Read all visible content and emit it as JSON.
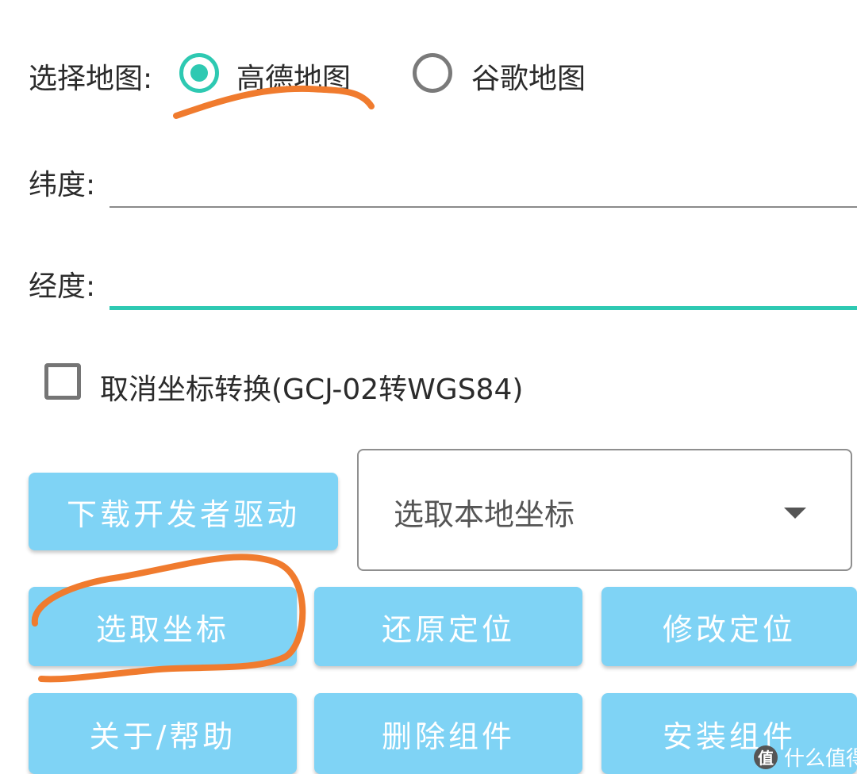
{
  "map_select": {
    "label": "选择地图:",
    "options": [
      {
        "label": "高德地图",
        "checked": true
      },
      {
        "label": "谷歌地图",
        "checked": false
      }
    ]
  },
  "latitude": {
    "label": "纬度:",
    "value": ""
  },
  "longitude": {
    "label": "经度:",
    "value": ""
  },
  "cancel_transform": {
    "label": "取消坐标转换(GCJ-02转WGS84)",
    "checked": false
  },
  "buttons": {
    "download_driver": "下载开发者驱动",
    "pick_coord": "选取坐标",
    "restore_location": "还原定位",
    "modify_location": "修改定位",
    "about_help": "关于/帮助",
    "delete_component": "删除组件",
    "install_component": "安装组件"
  },
  "local_coord_select": {
    "selected": "选取本地坐标"
  },
  "watermark": {
    "badge": "值",
    "text": "什么值得买"
  },
  "colors": {
    "accent": "#2ec9b2",
    "button": "#7fd3f5",
    "annotation": "#f07b2e"
  },
  "icons": [
    "radio-checked-icon",
    "radio-unchecked-icon",
    "checkbox-icon",
    "dropdown-caret-icon"
  ]
}
